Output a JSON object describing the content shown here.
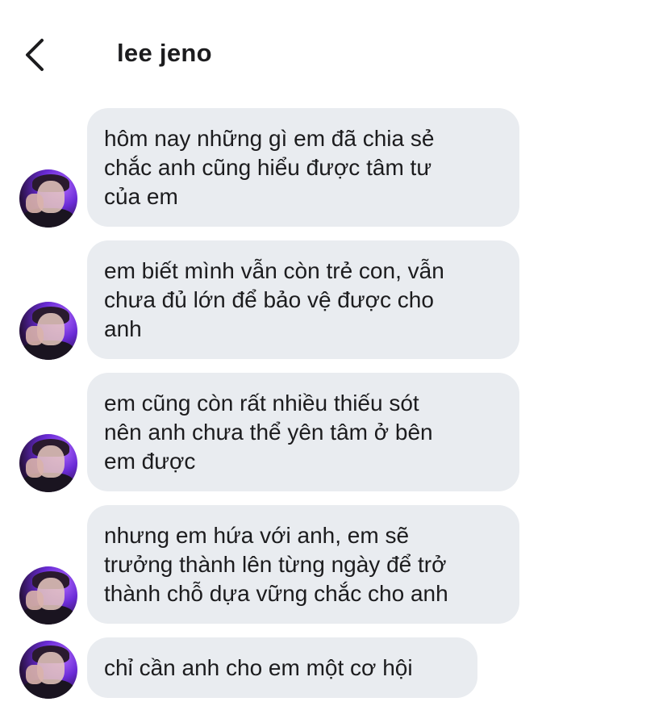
{
  "header": {
    "back_icon": "chevron-left-icon",
    "title": "lee jeno"
  },
  "messages": [
    {
      "text": "hôm nay những gì em đã chia sẻ\nchắc anh cũng hiểu được tâm tư\ncủa em"
    },
    {
      "text": "em biết mình vẫn còn trẻ con, vẫn\nchưa đủ lớn để bảo vệ được cho\nanh"
    },
    {
      "text": "em cũng còn rất nhiều thiếu sót\nnên anh chưa thể yên tâm ở bên\nem được"
    },
    {
      "text": "nhưng em hứa với anh, em sẽ\ntrưởng thành lên từng ngày để trở\nthành chỗ dựa vững chắc cho anh"
    },
    {
      "text": "chỉ cần anh cho em một cơ hội"
    }
  ],
  "colors": {
    "bubble_bg": "#e9ecf0",
    "text": "#1c1c1e",
    "background": "#ffffff"
  }
}
